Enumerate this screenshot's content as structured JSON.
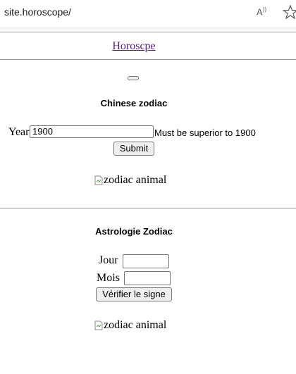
{
  "browser": {
    "url": "site.horoscope/",
    "read_aloud_icon": "read-aloud-icon",
    "favorite_icon": "star-icon"
  },
  "nav": {
    "link": "Horoscpe"
  },
  "chinese": {
    "title": "Chinese zodiac",
    "year_label": "Year",
    "year_value": "1900",
    "hint": "Must be superior to 1900",
    "submit": "Submit",
    "img_alt": "zodiac animal"
  },
  "astro": {
    "title": "Astrologie Zodiac",
    "day_label": "Jour",
    "day_value": "",
    "month_label": "Mois",
    "month_value": "",
    "check": "Vérifier le signe",
    "img_alt": "zodiac animal"
  },
  "colors": {
    "link": "#551a8b",
    "rule": "#9a9a9a",
    "button_bg": "#efefef"
  }
}
